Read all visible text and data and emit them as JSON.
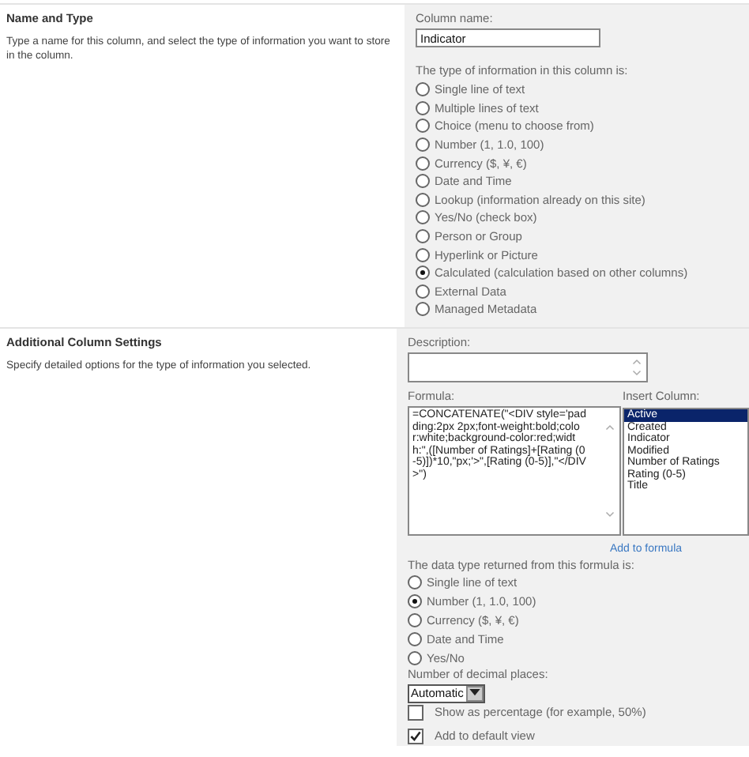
{
  "sections": [
    {
      "title": "Name and Type",
      "description": "Type a name for this column, and select the type of information you want to store in the column."
    },
    {
      "title": "Additional Column Settings",
      "description": "Specify detailed options for the type of information you selected."
    }
  ],
  "column_name": {
    "label": "Column name:",
    "value": "Indicator"
  },
  "type_group": {
    "label": "The type of information in this column is:",
    "options": [
      {
        "label": "Single line of text",
        "selected": false
      },
      {
        "label": "Multiple lines of text",
        "selected": false
      },
      {
        "label": "Choice (menu to choose from)",
        "selected": false
      },
      {
        "label": "Number (1, 1.0, 100)",
        "selected": false
      },
      {
        "label": "Currency ($, ¥, €)",
        "selected": false
      },
      {
        "label": "Date and Time",
        "selected": false
      },
      {
        "label": "Lookup (information already on this site)",
        "selected": false
      },
      {
        "label": "Yes/No (check box)",
        "selected": false
      },
      {
        "label": "Person or Group",
        "selected": false
      },
      {
        "label": "Hyperlink or Picture",
        "selected": false
      },
      {
        "label": "Calculated (calculation based on other columns)",
        "selected": true
      },
      {
        "label": "External Data",
        "selected": false
      },
      {
        "label": "Managed Metadata",
        "selected": false
      }
    ]
  },
  "description_field": {
    "label": "Description:"
  },
  "formula": {
    "label": "Formula:",
    "value": "=CONCATENATE(\"<DIV style='padding:2px 2px;font-weight:bold;color:white;background-color:red;width:\",([Number of Ratings]+[Rating (0-5)])*10,\"px;'>\",[Rating (0-5)],\"</DIV>\")"
  },
  "insert_column": {
    "label": "Insert Column:",
    "items": [
      {
        "label": "Active",
        "selected": true
      },
      {
        "label": "Created",
        "selected": false
      },
      {
        "label": "Indicator",
        "selected": false
      },
      {
        "label": "Modified",
        "selected": false
      },
      {
        "label": "Number of Ratings",
        "selected": false
      },
      {
        "label": "Rating (0-5)",
        "selected": false
      },
      {
        "label": "Title",
        "selected": false
      }
    ],
    "link": "Add to formula"
  },
  "return_type": {
    "label": "The data type returned from this formula is:",
    "options": [
      {
        "label": "Single line of text",
        "selected": false
      },
      {
        "label": "Number (1, 1.0, 100)",
        "selected": true
      },
      {
        "label": "Currency ($, ¥, €)",
        "selected": false
      },
      {
        "label": "Date and Time",
        "selected": false
      },
      {
        "label": "Yes/No",
        "selected": false
      }
    ]
  },
  "decimal_places": {
    "label": "Number of decimal places:",
    "value": "Automatic"
  },
  "checkboxes": [
    {
      "label": "Show as percentage (for example, 50%)",
      "checked": false
    },
    {
      "label": "Add to default view",
      "checked": true
    }
  ]
}
